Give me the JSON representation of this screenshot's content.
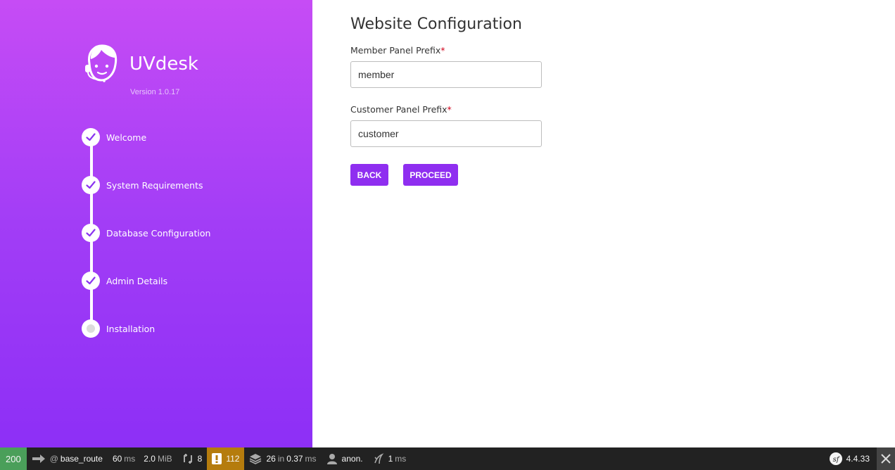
{
  "sidebar": {
    "brand": "UVdesk",
    "version": "Version 1.0.17",
    "steps": [
      {
        "label": "Welcome",
        "state": "done"
      },
      {
        "label": "System Requirements",
        "state": "done"
      },
      {
        "label": "Database Configuration",
        "state": "done"
      },
      {
        "label": "Admin Details",
        "state": "done"
      },
      {
        "label": "Installation",
        "state": "current"
      }
    ]
  },
  "main": {
    "title": "Website Configuration",
    "member_label": "Member Panel Prefix",
    "member_value": "member",
    "customer_label": "Customer Panel Prefix",
    "customer_value": "customer",
    "required_mark": "*",
    "back_label": "BACK",
    "proceed_label": "PROCEED"
  },
  "toolbar": {
    "status_code": "200",
    "route_at": "@",
    "route": "base_route",
    "time_value": "60",
    "time_unit": "ms",
    "memory_value": "2.0",
    "memory_unit": "MiB",
    "twig_count": "8",
    "warnings_count": "112",
    "db_queries": "26",
    "db_in": "in",
    "db_time": "0.37",
    "db_unit": "ms",
    "user": "anon.",
    "render_value": "1",
    "render_unit": "ms",
    "symfony_version": "4.4.33"
  },
  "colors": {
    "sidebar_top": "#c64cf5",
    "sidebar_bottom": "#8d2ff6",
    "button": "#8f2ef0",
    "status_ok": "#4a9f5a",
    "warning": "#b57c0d"
  }
}
